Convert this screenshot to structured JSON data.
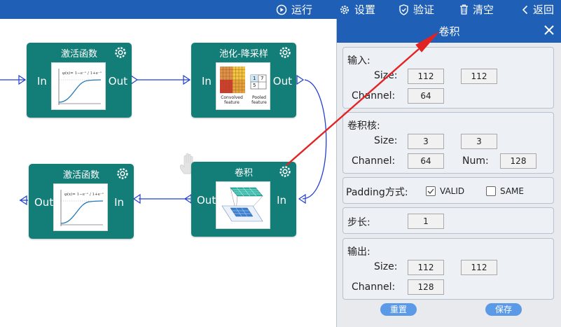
{
  "toolbar": {
    "run": "运行",
    "settings": "设置",
    "verify": "验证",
    "clear": "清空",
    "back": "返回"
  },
  "nodes": {
    "activation_top": {
      "title": "激活函数",
      "in": "In",
      "out": "Out"
    },
    "pooling": {
      "title": "池化-降采样",
      "in": "In",
      "out": "Out",
      "thumb_left": "Convolved feature",
      "thumb_right": "Pooled feature",
      "grid": [
        "1",
        "7",
        "5",
        ""
      ]
    },
    "conv": {
      "title": "卷积",
      "in": "In",
      "out": "Out"
    },
    "activation_bottom": {
      "title": "激活函数",
      "in": "In",
      "out": "Out"
    }
  },
  "panel": {
    "title": "卷积",
    "input": {
      "label": "输入:",
      "size_label": "Size:",
      "size_w": "112",
      "size_h": "112",
      "channel_label": "Channel:",
      "channel": "64"
    },
    "kernel": {
      "label": "卷积核:",
      "size_label": "Size:",
      "size_w": "3",
      "size_h": "3",
      "channel_label": "Channel:",
      "channel": "64",
      "num_label": "Num:",
      "num": "128"
    },
    "padding": {
      "label": "Padding方式:",
      "valid": "VALID",
      "same": "SAME",
      "valid_checked": true,
      "same_checked": false
    },
    "stride": {
      "label": "步长:",
      "value": "1"
    },
    "output": {
      "label": "输出:",
      "size_label": "Size:",
      "size_w": "112",
      "size_h": "112",
      "channel_label": "Channel:",
      "channel": "128"
    },
    "reset": "重置",
    "save": "保存"
  },
  "colors": {
    "toolbar": "#1f5fb6",
    "node": "#137d78",
    "wire": "#1f3fd6",
    "arrow": "#e32222",
    "button": "#5b9ae6"
  }
}
